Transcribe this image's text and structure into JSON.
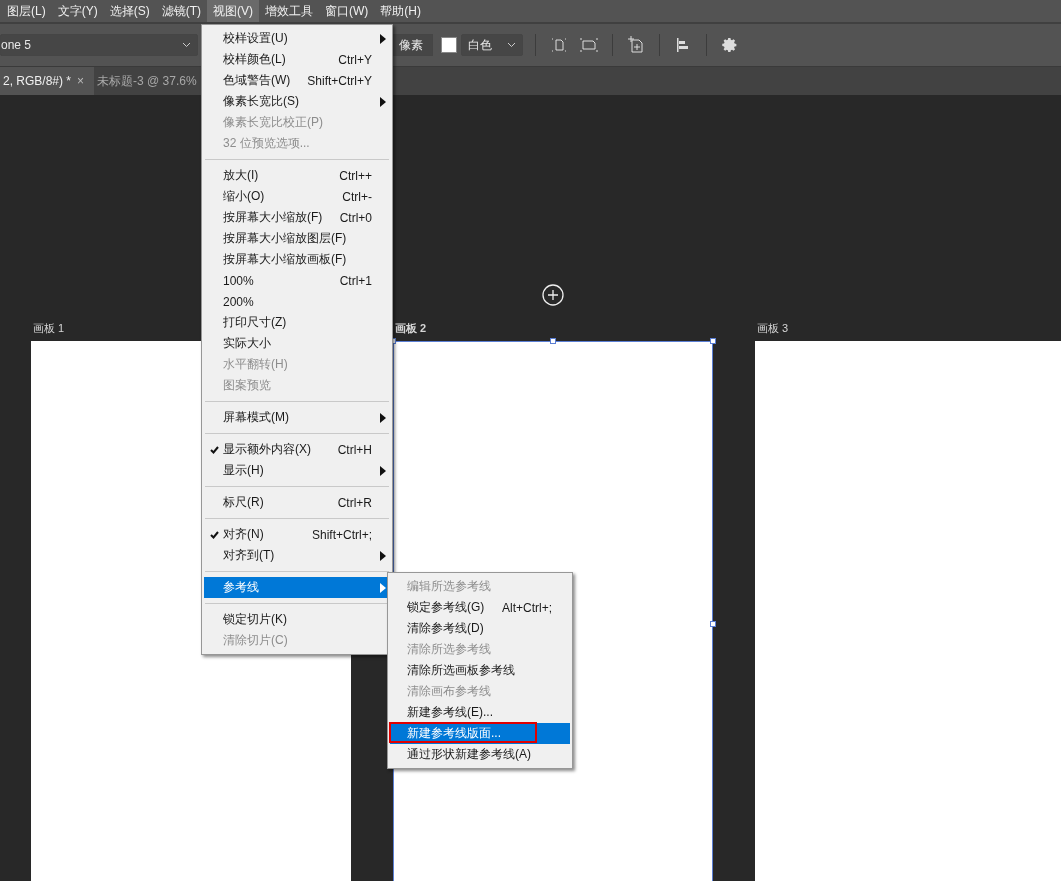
{
  "menu_bar": [
    {
      "label": "图层(L)",
      "selected": false
    },
    {
      "label": "文字(Y)",
      "selected": false
    },
    {
      "label": "选择(S)",
      "selected": false
    },
    {
      "label": "滤镜(T)",
      "selected": false
    },
    {
      "label": "视图(V)",
      "selected": true
    },
    {
      "label": "增效工具",
      "selected": false
    },
    {
      "label": "窗口(W)",
      "selected": false
    },
    {
      "label": "帮助(H)",
      "selected": false
    }
  ],
  "options_bar": {
    "preset": "one 5",
    "unit_field": "像素",
    "fill_dropdown": "白色"
  },
  "document_tabs": [
    {
      "label": "2, RGB/8#) *",
      "close": "×",
      "selected": true
    },
    {
      "label": "未标题-3 @ 37.6%",
      "selected": false
    }
  ],
  "artboards": [
    {
      "label": "画板 1",
      "selected": false
    },
    {
      "label": "画板 2",
      "selected": true
    },
    {
      "label": "画板 3",
      "selected": false
    }
  ],
  "view_menu": [
    {
      "kind": "item",
      "label": "校样设置(U)",
      "submenu": true,
      "disabled": false,
      "checked": false,
      "selected": false
    },
    {
      "kind": "item",
      "label": "校样颜色(L)",
      "shortcut": "Ctrl+Y",
      "submenu": false,
      "disabled": false,
      "checked": false,
      "selected": false
    },
    {
      "kind": "item",
      "label": "色域警告(W)",
      "shortcut": "Shift+Ctrl+Y",
      "submenu": false,
      "disabled": false,
      "checked": false,
      "selected": false
    },
    {
      "kind": "item",
      "label": "像素长宽比(S)",
      "submenu": true,
      "disabled": false,
      "checked": false,
      "selected": false
    },
    {
      "kind": "item",
      "label": "像素长宽比校正(P)",
      "submenu": false,
      "disabled": true,
      "checked": false,
      "selected": false
    },
    {
      "kind": "item",
      "label": "32 位预览选项...",
      "submenu": false,
      "disabled": true,
      "checked": false,
      "selected": false
    },
    {
      "kind": "separator"
    },
    {
      "kind": "item",
      "label": "放大(I)",
      "shortcut": "Ctrl++",
      "submenu": false,
      "disabled": false,
      "checked": false,
      "selected": false
    },
    {
      "kind": "item",
      "label": "缩小(O)",
      "shortcut": "Ctrl+-",
      "submenu": false,
      "disabled": false,
      "checked": false,
      "selected": false
    },
    {
      "kind": "item",
      "label": "按屏幕大小缩放(F)",
      "shortcut": "Ctrl+0",
      "submenu": false,
      "disabled": false,
      "checked": false,
      "selected": false
    },
    {
      "kind": "item",
      "label": "按屏幕大小缩放图层(F)",
      "submenu": false,
      "disabled": false,
      "checked": false,
      "selected": false
    },
    {
      "kind": "item",
      "label": "按屏幕大小缩放画板(F)",
      "submenu": false,
      "disabled": false,
      "checked": false,
      "selected": false
    },
    {
      "kind": "item",
      "label": "100%",
      "shortcut": "Ctrl+1",
      "submenu": false,
      "disabled": false,
      "checked": false,
      "selected": false
    },
    {
      "kind": "item",
      "label": "200%",
      "submenu": false,
      "disabled": false,
      "checked": false,
      "selected": false
    },
    {
      "kind": "item",
      "label": "打印尺寸(Z)",
      "submenu": false,
      "disabled": false,
      "checked": false,
      "selected": false
    },
    {
      "kind": "item",
      "label": "实际大小",
      "submenu": false,
      "disabled": false,
      "checked": false,
      "selected": false
    },
    {
      "kind": "item",
      "label": "水平翻转(H)",
      "submenu": false,
      "disabled": true,
      "checked": false,
      "selected": false
    },
    {
      "kind": "item",
      "label": "图案预览",
      "submenu": false,
      "disabled": true,
      "checked": false,
      "selected": false
    },
    {
      "kind": "separator"
    },
    {
      "kind": "item",
      "label": "屏幕模式(M)",
      "submenu": true,
      "disabled": false,
      "checked": false,
      "selected": false
    },
    {
      "kind": "separator"
    },
    {
      "kind": "item",
      "label": "显示额外内容(X)",
      "shortcut": "Ctrl+H",
      "submenu": false,
      "disabled": false,
      "checked": true,
      "selected": false
    },
    {
      "kind": "item",
      "label": "显示(H)",
      "submenu": true,
      "disabled": false,
      "checked": false,
      "selected": false
    },
    {
      "kind": "separator"
    },
    {
      "kind": "item",
      "label": "标尺(R)",
      "shortcut": "Ctrl+R",
      "submenu": false,
      "disabled": false,
      "checked": false,
      "selected": false
    },
    {
      "kind": "separator"
    },
    {
      "kind": "item",
      "label": "对齐(N)",
      "shortcut": "Shift+Ctrl+;",
      "submenu": false,
      "disabled": false,
      "checked": true,
      "selected": false
    },
    {
      "kind": "item",
      "label": "对齐到(T)",
      "submenu": true,
      "disabled": false,
      "checked": false,
      "selected": false
    },
    {
      "kind": "separator"
    },
    {
      "kind": "item",
      "label": "参考线",
      "submenu": true,
      "disabled": false,
      "checked": false,
      "selected": true
    },
    {
      "kind": "separator"
    },
    {
      "kind": "item",
      "label": "锁定切片(K)",
      "submenu": false,
      "disabled": false,
      "checked": false,
      "selected": false
    },
    {
      "kind": "item",
      "label": "清除切片(C)",
      "submenu": false,
      "disabled": true,
      "checked": false,
      "selected": false
    }
  ],
  "guides_submenu": [
    {
      "label": "编辑所选参考线",
      "disabled": true,
      "selected": false,
      "outlined": false
    },
    {
      "label": "锁定参考线(G)",
      "shortcut": "Alt+Ctrl+;",
      "disabled": false,
      "selected": false,
      "outlined": false
    },
    {
      "label": "清除参考线(D)",
      "disabled": false,
      "selected": false,
      "outlined": false
    },
    {
      "label": "清除所选参考线",
      "disabled": true,
      "selected": false,
      "outlined": false
    },
    {
      "label": "清除所选画板参考线",
      "disabled": false,
      "selected": false,
      "outlined": false
    },
    {
      "label": "清除画布参考线",
      "disabled": true,
      "selected": false,
      "outlined": false
    },
    {
      "label": "新建参考线(E)...",
      "disabled": false,
      "selected": false,
      "outlined": false
    },
    {
      "label": "新建参考线版面...",
      "disabled": false,
      "selected": true,
      "outlined": true
    },
    {
      "label": "通过形状新建参考线(A)",
      "disabled": false,
      "selected": false,
      "outlined": false
    }
  ]
}
